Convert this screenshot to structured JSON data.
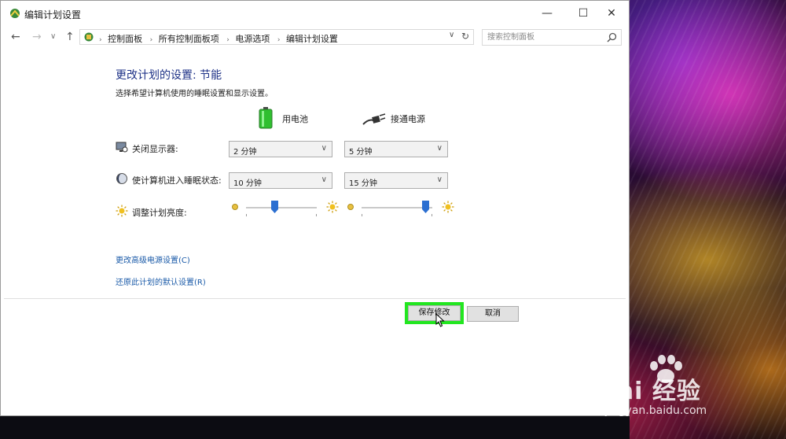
{
  "window": {
    "title": "编辑计划设置",
    "controls": {
      "minimize": "—",
      "maximize": "☐",
      "close": "✕"
    }
  },
  "address": {
    "breadcrumbs": [
      "控制面板",
      "所有控制面板项",
      "电源选项",
      "编辑计划设置"
    ],
    "search_placeholder": "搜索控制面板"
  },
  "page": {
    "title": "更改计划的设置: 节能",
    "subtitle": "选择希望计算机使用的睡眠设置和显示设置。"
  },
  "columns": {
    "battery": "用电池",
    "plugged_in": "接通电源"
  },
  "rows": {
    "display_off": {
      "label": "关闭显示器:",
      "battery": "2 分钟",
      "plugged_in": "5 分钟"
    },
    "sleep": {
      "label": "使计算机进入睡眠状态:",
      "battery": "10 分钟",
      "plugged_in": "15 分钟"
    },
    "brightness": {
      "label": "调整计划亮度:",
      "battery_level": 0.4,
      "plugged_in_level": 0.9
    }
  },
  "links": {
    "advanced": "更改高级电源设置(C)",
    "restore": "还原此计划的默认设置(R)"
  },
  "buttons": {
    "save": "保存修改",
    "cancel": "取消"
  },
  "watermark": {
    "main": "Bai 经验",
    "sub": "jingyan.baidu.com"
  },
  "colors": {
    "title_blue": "#1e3287",
    "link_blue": "#1a5aa8",
    "highlight_green": "#22e620",
    "slider_blue": "#2b6fd1"
  }
}
